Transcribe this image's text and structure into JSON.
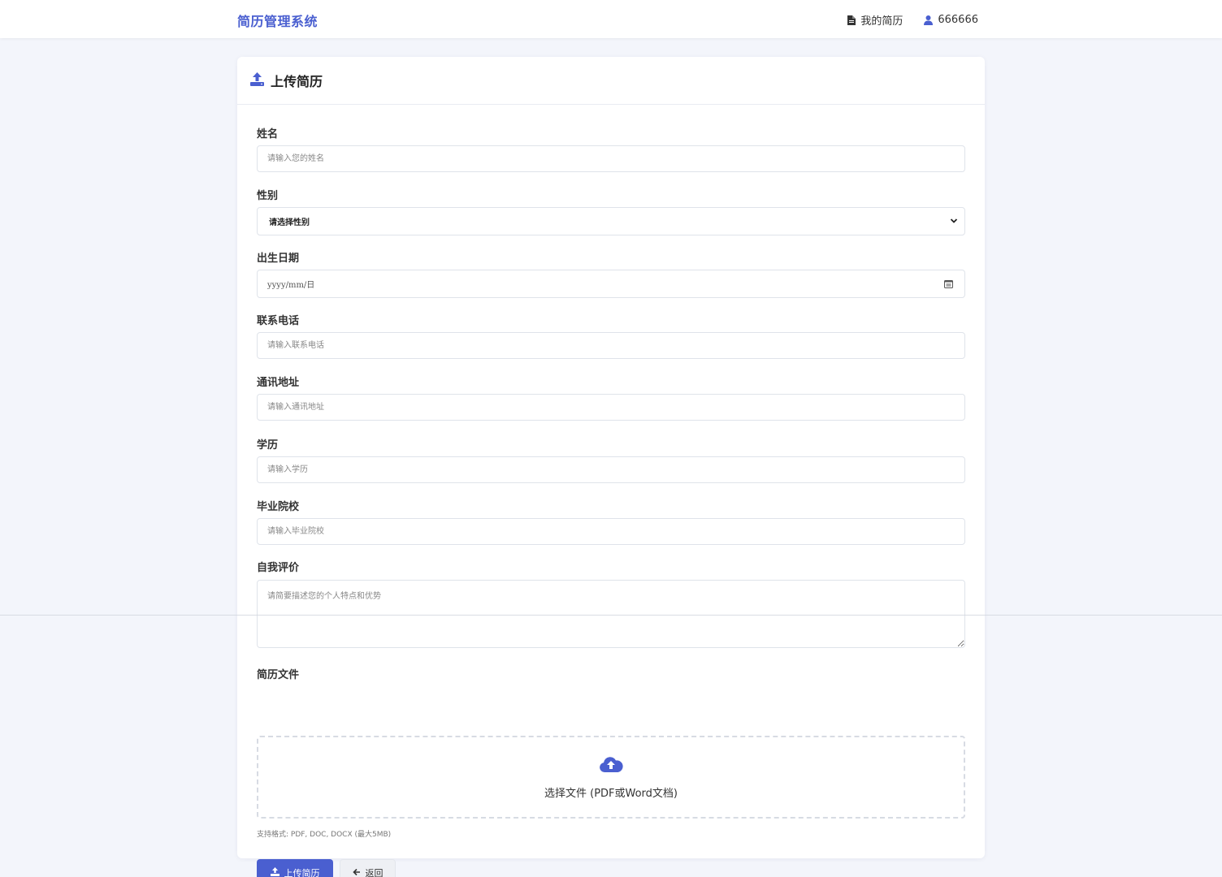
{
  "navbar": {
    "brand": "简历管理系统",
    "my_resume": "我的简历",
    "username": "666666"
  },
  "card": {
    "title": "上传简历"
  },
  "form": {
    "name": {
      "label": "姓名",
      "placeholder": "请输入您的姓名"
    },
    "gender": {
      "label": "性别",
      "selected": "请选择性别"
    },
    "birthdate": {
      "label": "出生日期",
      "value": "yyyy/mm/日"
    },
    "phone": {
      "label": "联系电话",
      "placeholder": "请输入联系电话"
    },
    "address": {
      "label": "通讯地址",
      "placeholder": "请输入通讯地址"
    },
    "education": {
      "label": "学历",
      "placeholder": "请输入学历"
    },
    "school": {
      "label": "毕业院校",
      "placeholder": "请输入毕业院校"
    },
    "self_evaluation": {
      "label": "自我评价",
      "placeholder": "请简要描述您的个人特点和优势"
    },
    "resume_file": {
      "label": "简历文件",
      "dropzone_text": "选择文件 (PDF或Word文档)",
      "hint": "支持格式: PDF, DOC, DOCX (最大5MB)"
    }
  },
  "actions": {
    "upload": "上传简历",
    "back": "返回"
  },
  "colors": {
    "accent": "#4a5fd0",
    "background": "#f3f5fb"
  }
}
